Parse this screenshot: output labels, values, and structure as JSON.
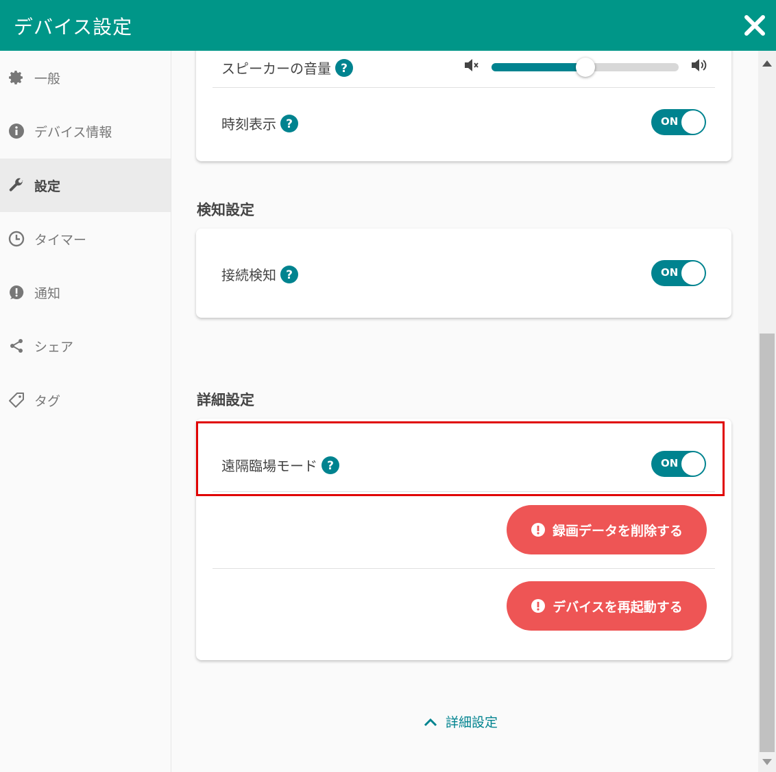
{
  "header": {
    "title": "デバイス設定",
    "close_icon": "close-icon",
    "bg_color": "#009688"
  },
  "sidebar": {
    "items": [
      {
        "label": "一般",
        "icon": "gear-icon",
        "active": false
      },
      {
        "label": "デバイス情報",
        "icon": "info-icon",
        "active": false
      },
      {
        "label": "設定",
        "icon": "wrench-icon",
        "active": true
      },
      {
        "label": "タイマー",
        "icon": "clock-icon",
        "active": false
      },
      {
        "label": "通知",
        "icon": "notification-icon",
        "active": false
      },
      {
        "label": "シェア",
        "icon": "share-icon",
        "active": false
      },
      {
        "label": "タグ",
        "icon": "tag-icon",
        "active": false
      }
    ]
  },
  "card1": {
    "speaker_volume": {
      "label": "スピーカーの音量",
      "value_fraction": 0.5
    },
    "time_display": {
      "label": "時刻表示",
      "toggle": "ON"
    }
  },
  "detection": {
    "title": "検知設定",
    "connection_detection": {
      "label": "接続検知",
      "toggle": "ON"
    }
  },
  "advanced": {
    "title": "詳細設定",
    "remote_mode": {
      "label": "遠隔臨場モード",
      "toggle": "ON"
    },
    "delete_recording_button": "録画データを削除する",
    "restart_device_button": "デバイスを再起動する"
  },
  "collapse_link": "詳細設定",
  "colors": {
    "accent": "#00838f",
    "danger": "#ee5555",
    "highlight": "#e00000"
  }
}
